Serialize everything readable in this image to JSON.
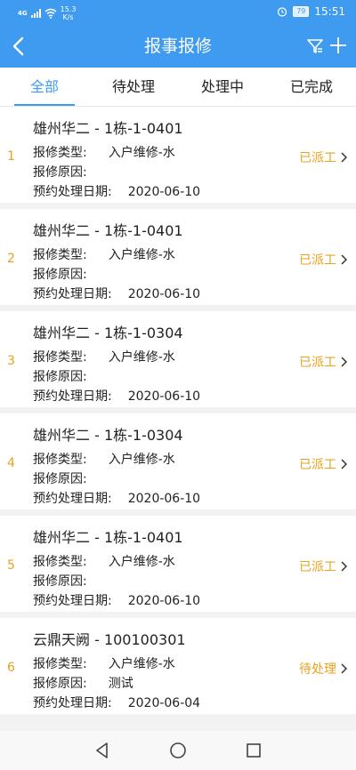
{
  "status_bar": {
    "network": "4G",
    "data_speed_value": "15.3",
    "data_speed_unit": "K/s",
    "battery": "79",
    "time": "15:51"
  },
  "nav": {
    "title": "报事报修"
  },
  "tabs": [
    {
      "label": "全部",
      "active": true
    },
    {
      "label": "待处理",
      "active": false
    },
    {
      "label": "处理中",
      "active": false
    },
    {
      "label": "已完成",
      "active": false
    }
  ],
  "labels": {
    "repair_type": "报修类型:",
    "repair_reason": "报修原因:",
    "appointment_date": "预约处理日期:"
  },
  "items": [
    {
      "index": "1",
      "title": "雄州华二 - 1栋-1-0401",
      "repair_type": "入户维修-水",
      "repair_reason": "",
      "date": "2020-06-10",
      "status": "已派工"
    },
    {
      "index": "2",
      "title": "雄州华二 - 1栋-1-0401",
      "repair_type": "入户维修-水",
      "repair_reason": "",
      "date": "2020-06-10",
      "status": "已派工"
    },
    {
      "index": "3",
      "title": "雄州华二 - 1栋-1-0304",
      "repair_type": "入户维修-水",
      "repair_reason": "",
      "date": "2020-06-10",
      "status": "已派工"
    },
    {
      "index": "4",
      "title": "雄州华二 - 1栋-1-0304",
      "repair_type": "入户维修-水",
      "repair_reason": "",
      "date": "2020-06-10",
      "status": "已派工"
    },
    {
      "index": "5",
      "title": "雄州华二 - 1栋-1-0401",
      "repair_type": "入户维修-水",
      "repair_reason": "",
      "date": "2020-06-10",
      "status": "已派工"
    },
    {
      "index": "6",
      "title": "云鼎天阙 - 100100301",
      "repair_type": "入户维修-水",
      "repair_reason": "测试",
      "date": "2020-06-04",
      "status": "待处理"
    }
  ],
  "colors": {
    "primary": "#3f9bf0",
    "status_orange": "#e9a21c",
    "background": "#f2f2f2"
  },
  "icons": {
    "back": "chevron-left-icon",
    "filter": "filter-icon",
    "add": "plus-icon",
    "item_arrow": "chevron-right-icon",
    "system_back": "triangle-back-icon",
    "system_home": "circle-home-icon",
    "system_recent": "square-recent-icon"
  }
}
